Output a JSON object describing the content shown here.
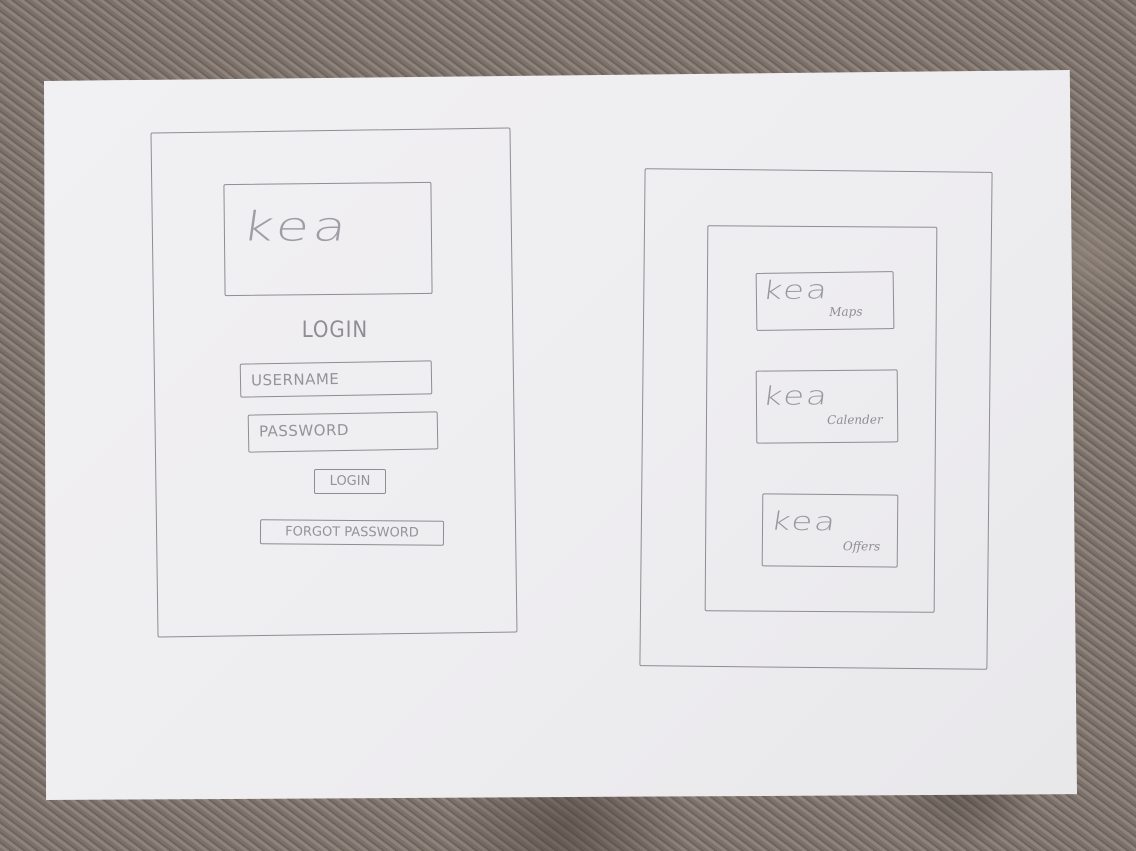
{
  "login_screen": {
    "logo": "kea",
    "heading": "LOGIN",
    "username_placeholder": "USERNAME",
    "password_placeholder": "PASSWORD",
    "login_button": "LOGIN",
    "forgot_password_button": "FORGOT PASSWORD"
  },
  "menu_screen": {
    "tiles": [
      {
        "brand": "kea",
        "label": "Maps"
      },
      {
        "brand": "kea",
        "label": "Calender"
      },
      {
        "brand": "kea",
        "label": "Offers"
      }
    ]
  }
}
